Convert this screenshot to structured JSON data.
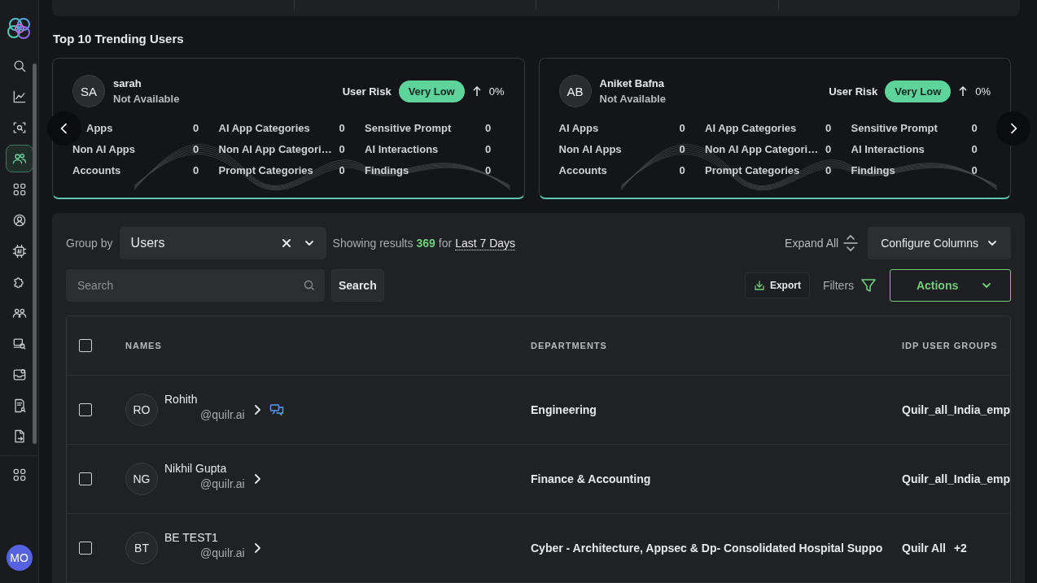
{
  "sidebar": {
    "items": [
      {
        "selected": false
      },
      {
        "selected": false
      },
      {
        "selected": false
      },
      {
        "selected": true
      },
      {
        "selected": false
      },
      {
        "selected": false
      },
      {
        "selected": false
      },
      {
        "selected": false
      },
      {
        "selected": false
      },
      {
        "selected": false
      },
      {
        "selected": false
      },
      {
        "selected": false
      },
      {
        "selected": false
      }
    ],
    "bottom_items": [
      {
        "selected": false
      }
    ],
    "avatar": "MO"
  },
  "section_title": "Top 10 Trending Users",
  "trending_users": [
    {
      "initials": "SA",
      "name": "sarah",
      "subtitle": "Not Available",
      "risk_label": "User Risk",
      "risk": "Very Low",
      "trend": "0%",
      "stats": [
        {
          "label": "Apps",
          "value": "0",
          "kind": "covered"
        },
        {
          "label": "AI App Categories",
          "value": "0"
        },
        {
          "label": "Sensitive Prompt",
          "value": "0"
        },
        {
          "label": "Non AI Apps",
          "value": "0"
        },
        {
          "label": "Non AI App Categori…",
          "value": "0"
        },
        {
          "label": "AI Interactions",
          "value": "0"
        },
        {
          "label": "Accounts",
          "value": "0"
        },
        {
          "label": "Prompt Categories",
          "value": "0"
        },
        {
          "label": "Findings",
          "value": "0"
        }
      ]
    },
    {
      "initials": "AB",
      "name": "Aniket Bafna",
      "subtitle": "Not Available",
      "risk_label": "User Risk",
      "risk": "Very Low",
      "trend": "0%",
      "stats": [
        {
          "label": "AI Apps",
          "value": "0"
        },
        {
          "label": "AI App Categories",
          "value": "0"
        },
        {
          "label": "Sensitive Prompt",
          "value": "0"
        },
        {
          "label": "Non AI Apps",
          "value": "0"
        },
        {
          "label": "Non AI App Categori…",
          "value": "0"
        },
        {
          "label": "AI Interactions",
          "value": "0"
        },
        {
          "label": "Accounts",
          "value": "0"
        },
        {
          "label": "Prompt Categories",
          "value": "0"
        },
        {
          "label": "Findings",
          "value": "0"
        }
      ]
    }
  ],
  "toolbar": {
    "group_by_label": "Group by",
    "group_by_value": "Users",
    "results_prefix": "Showing results",
    "results_count": "369",
    "results_for": "for",
    "date_range": "Last 7 Days",
    "expand_all": "Expand All",
    "configure_columns": "Configure Columns",
    "search_placeholder": "Search",
    "search_button": "Search",
    "export": "Export",
    "filters": "Filters",
    "actions": "Actions"
  },
  "table": {
    "all_checked": false,
    "columns": [
      "NAMES",
      "DEPARTMENTS",
      "IDP USER GROUPS"
    ],
    "rows": [
      {
        "checked": false,
        "initials": "RO",
        "name": "Rohith",
        "email": "@quilr.ai",
        "has_comment": true,
        "department": "Engineering",
        "group": "Quilr_all_India_emp"
      },
      {
        "checked": false,
        "initials": "NG",
        "name": "Nikhil Gupta",
        "email": "@quilr.ai",
        "has_comment": false,
        "department": "Finance & Accounting",
        "group": "Quilr_all_India_emp"
      },
      {
        "checked": false,
        "initials": "BT",
        "name": "BE TEST1",
        "email": "@quilr.ai",
        "has_comment": false,
        "department": "Cyber - Architecture, Appsec & Dp- Consolidated Hospital Suppo",
        "group": "Quilr All",
        "group_more": "+2"
      }
    ]
  }
}
